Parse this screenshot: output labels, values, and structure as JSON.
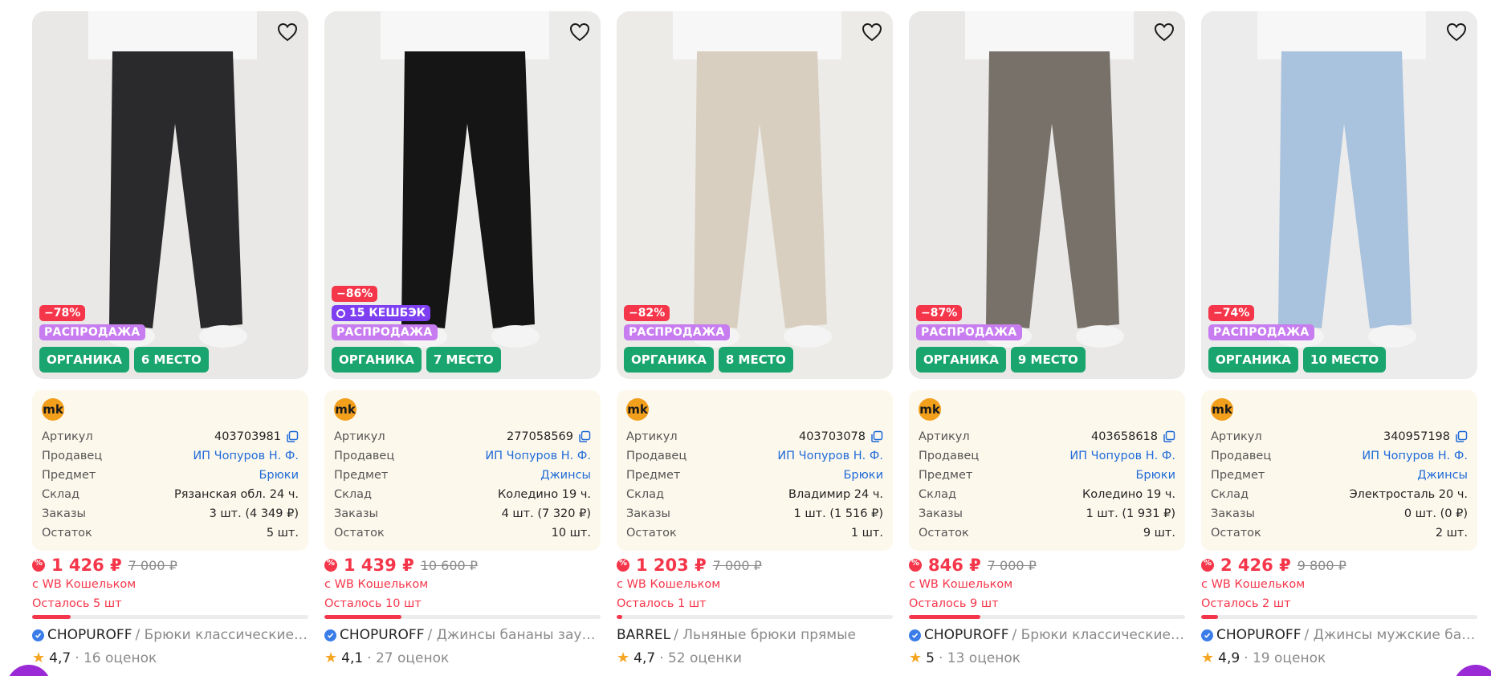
{
  "colors": {
    "accent": "#f5364a",
    "sale": "#c77cf0",
    "cashback": "#7e3ff2",
    "green": "#1aa56e",
    "link": "#1f6bd8"
  },
  "labels": {
    "article": "Артикул",
    "seller": "Продавец",
    "subject": "Предмет",
    "warehouse": "Склад",
    "orders": "Заказы",
    "stock": "Остаток",
    "wallet": "с WB Кошельком",
    "sale_badge": "РАСПРОДАЖА",
    "organic_badge": "ОРГАНИКА",
    "seller_logo": "mk"
  },
  "products": [
    {
      "discount": "−78%",
      "cashback": "",
      "place": "6 МЕСТО",
      "article": "403703981",
      "seller": "ИП Чопуров Н. Ф.",
      "subject": "Брюки",
      "warehouse": "Рязанская обл. 24 ч.",
      "orders": "3 шт. (4 349 ₽)",
      "stock": "5 шт.",
      "price": "1 426 ₽",
      "old_price": "7 000 ₽",
      "left": "Осталось 5 шт",
      "left_fill": 0.14,
      "brand": "CHOPUROFF",
      "verified": true,
      "name": " / Брюки классические п...",
      "rating": "4,7",
      "reviews": "· 16 оценок",
      "pant": "#2a2a2c",
      "bg": "#e9e8e6"
    },
    {
      "discount": "−86%",
      "cashback": "15 КЕШБЭК",
      "place": "7 МЕСТО",
      "article": "277058569",
      "seller": "ИП Чопуров Н. Ф.",
      "subject": "Джинсы",
      "warehouse": "Коледино 19 ч.",
      "orders": "4 шт. (7 320 ₽)",
      "stock": "10 шт.",
      "price": "1 439 ₽",
      "old_price": "10 600 ₽",
      "left": "Осталось 10 шт",
      "left_fill": 0.28,
      "brand": "CHOPUROFF",
      "verified": true,
      "name": " / Джинсы бананы зауже...",
      "rating": "4,1",
      "reviews": "· 27 оценок",
      "pant": "#151515",
      "bg": "#ebebe9"
    },
    {
      "discount": "−82%",
      "cashback": "",
      "place": "8 МЕСТО",
      "article": "403703078",
      "seller": "ИП Чопуров Н. Ф.",
      "subject": "Брюки",
      "warehouse": "Владимир 24 ч.",
      "orders": "1 шт. (1 516 ₽)",
      "stock": "1 шт.",
      "price": "1 203 ₽",
      "old_price": "7 000 ₽",
      "left": "Осталось 1 шт",
      "left_fill": 0.02,
      "brand": "BARREL",
      "verified": false,
      "name": " / Льняные брюки прямые",
      "rating": "4,7",
      "reviews": "· 52 оценки",
      "pant": "#d9cfc1",
      "bg": "#ecebe8"
    },
    {
      "discount": "−87%",
      "cashback": "",
      "place": "9 МЕСТО",
      "article": "403658618",
      "seller": "ИП Чопуров Н. Ф.",
      "subject": "Брюки",
      "warehouse": "Коледино 19 ч.",
      "orders": "1 шт. (1 931 ₽)",
      "stock": "9 шт.",
      "price": "846 ₽",
      "old_price": "7 000 ₽",
      "left": "Осталось 9 шт",
      "left_fill": 0.26,
      "brand": "CHOPUROFF",
      "verified": true,
      "name": " / Брюки классические п...",
      "rating": "5",
      "reviews": "· 13 оценок",
      "pant": "#77716a",
      "bg": "#e9e8e6"
    },
    {
      "discount": "−74%",
      "cashback": "",
      "place": "10 МЕСТО",
      "article": "340957198",
      "seller": "ИП Чопуров Н. Ф.",
      "subject": "Джинсы",
      "warehouse": "Электросталь 20 ч.",
      "orders": "0 шт. (0 ₽)",
      "stock": "2 шт.",
      "price": "2 426 ₽",
      "old_price": "9 800 ₽",
      "left": "Осталось 2 шт",
      "left_fill": 0.06,
      "brand": "CHOPUROFF",
      "verified": true,
      "name": " / Джинсы мужские бана...",
      "rating": "4,9",
      "reviews": "· 19 оценок",
      "pant": "#a9c2dd",
      "bg": "#ececec"
    }
  ]
}
